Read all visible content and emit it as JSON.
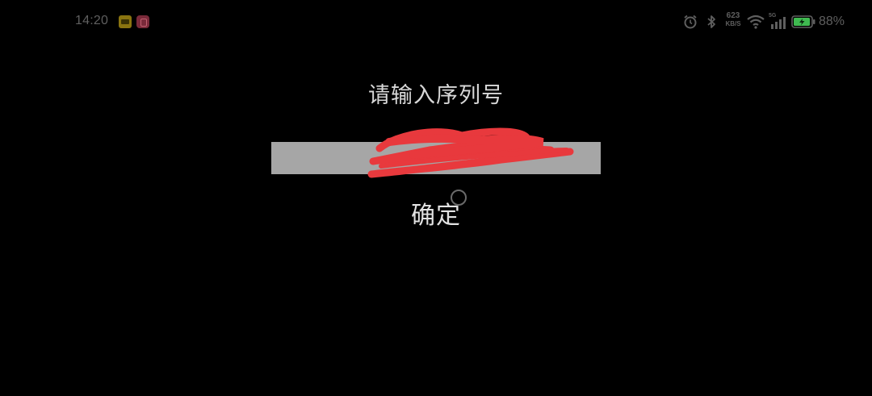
{
  "status_bar": {
    "time": "14:20",
    "network_speed_top": "623",
    "network_speed_bottom": "KB/S",
    "signal_label": "5G",
    "battery_percent": "88%",
    "icons": [
      "alarm-icon",
      "bluetooth-icon",
      "network-speed-icon",
      "wifi-icon",
      "cellular-signal-icon",
      "battery-charging-icon"
    ]
  },
  "dialog": {
    "title": "请输入序列号",
    "serial_input_value": "",
    "confirm_label": "确定"
  },
  "colors": {
    "background": "#000000",
    "input_background": "#a6a6a6",
    "text": "#d8d8d8",
    "redaction": "#e8393d",
    "battery_fill": "#3fb950"
  }
}
